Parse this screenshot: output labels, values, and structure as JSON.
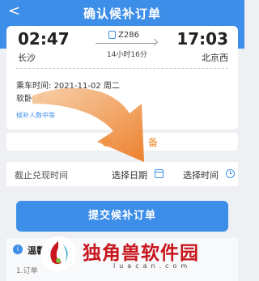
{
  "header": {
    "back_icon": "chevron-left-icon",
    "back_glyph": "<",
    "title": "确认候补订单"
  },
  "trip": {
    "departure_time": "02:47",
    "arrival_time": "17:03",
    "departure_station": "长沙",
    "arrival_station": "北京西",
    "train_number": "Z286",
    "duration": "14小时16分"
  },
  "details": {
    "depart_label": "乘车时间:",
    "depart_value": "2021-11-02 周二",
    "seat_label": "软卧:",
    "seat_value": "¥...",
    "waitlist_link": "候补人数中等"
  },
  "section": {
    "orange_label": "备"
  },
  "deadline": {
    "label": "截止兑现时间",
    "pick_date": "选择日期",
    "pick_time": "选择时间"
  },
  "submit": {
    "label": "提交候补订单"
  },
  "tips": {
    "title": "温馨",
    "line": "1.订单"
  },
  "watermark": {
    "text": "独角兽软件园",
    "domain": "luacan.com"
  },
  "colors": {
    "brand_blue": "#3d8ee8",
    "accent_orange": "#e98a27",
    "watermark_red": "#c8161d"
  }
}
